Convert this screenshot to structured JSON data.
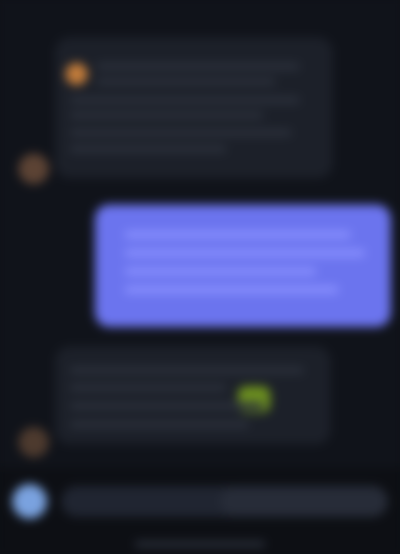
{
  "app": {
    "title": ""
  },
  "conversation": {
    "messages": [
      {
        "role": "incoming",
        "text": ""
      },
      {
        "role": "outgoing",
        "text": ""
      },
      {
        "role": "incoming",
        "text": ""
      }
    ]
  },
  "composer": {
    "input_placeholder": "",
    "send_label": ""
  }
}
